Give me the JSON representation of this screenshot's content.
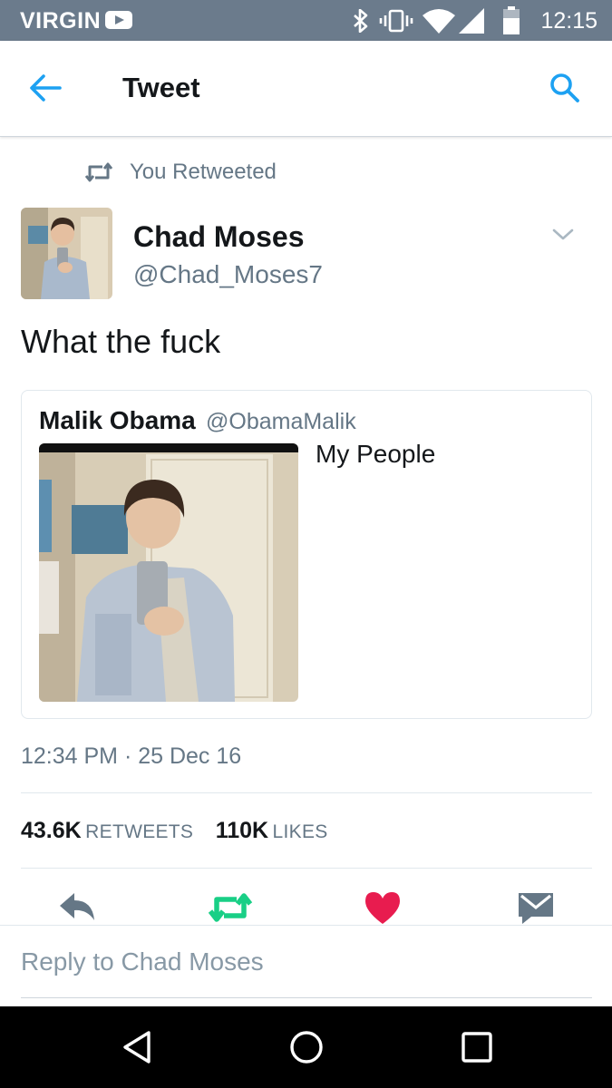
{
  "status_bar": {
    "carrier": "VIRGIN",
    "time": "12:15",
    "icons": [
      "play-icon",
      "bluetooth-icon",
      "vibrate-icon",
      "wifi-icon",
      "signal-icon",
      "battery-icon"
    ]
  },
  "app_bar": {
    "title": "Tweet"
  },
  "retweet_context": {
    "text": "You Retweeted"
  },
  "tweet": {
    "author_name": "Chad Moses",
    "author_handle": "@Chad_Moses7",
    "text": "What the fuck",
    "timestamp": "12:34 PM · 25 Dec 16",
    "quoted": {
      "author_name": "Malik Obama",
      "author_handle": "@ObamaMalik",
      "text": "My People"
    },
    "stats": {
      "retweets_count": "43.6K",
      "retweets_label": "RETWEETS",
      "likes_count": "110K",
      "likes_label": "LIKES"
    }
  },
  "reply": {
    "placeholder": "Reply to Chad Moses"
  },
  "colors": {
    "status_bar": "#6b7b8c",
    "accent_blue": "#1da1f2",
    "retweet_green": "#19cf86",
    "like_red": "#e81c4f",
    "secondary_text": "#657786"
  }
}
